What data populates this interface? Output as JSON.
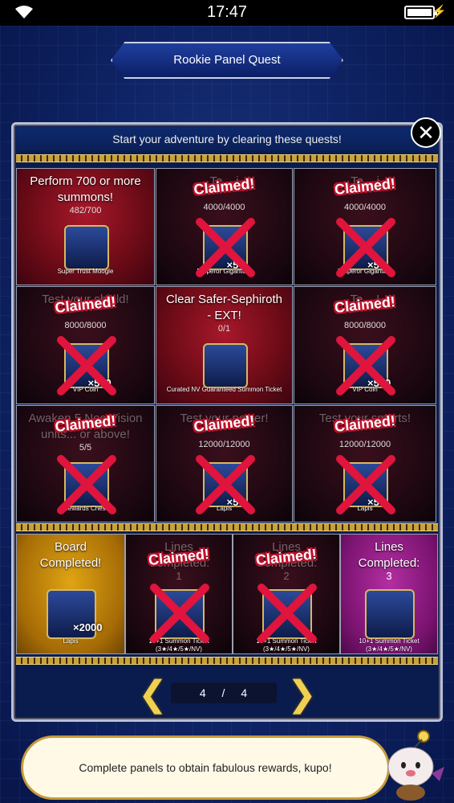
{
  "status": {
    "time": "17:47"
  },
  "header": {
    "title": "Rookie Panel Quest"
  },
  "panel": {
    "subtitle": "Start your adventure by clearing these quests!",
    "close_label": "✕"
  },
  "claimed_label": "Claimed!",
  "grid": [
    {
      "title": "Perform 700 or more summons!",
      "progress": "482/700",
      "reward": "Super Trust Moogle",
      "qty": "",
      "claimed": false,
      "style": "red"
    },
    {
      "title": "Te... i",
      "progress": "4000/4000",
      "reward": "Emperor Gigantuar",
      "qty": "×5",
      "claimed": true,
      "style": "dark"
    },
    {
      "title": "Te... i",
      "progress": "4000/4000",
      "reward": "Emperor Gigantuar",
      "qty": "×5",
      "claimed": true,
      "style": "dark"
    },
    {
      "title": "Test your shield!",
      "progress": "8000/8000",
      "reward": "VIP Coin",
      "qty": "×500",
      "claimed": true,
      "style": "dark"
    },
    {
      "title": "Clear Safer-Sephiroth - EXT!",
      "progress": "0/1",
      "reward": "Curated NV Guaranteed Summon Ticket",
      "qty": "",
      "claimed": false,
      "style": "red"
    },
    {
      "title": "Te... !",
      "progress": "8000/8000",
      "reward": "VIP Coin",
      "qty": "×500",
      "claimed": true,
      "style": "dark"
    },
    {
      "title": "Awaken 5 Neo Vision units... or above!",
      "progress": "5/5",
      "reward": "Rewards Chest",
      "qty": "",
      "claimed": true,
      "style": "dark"
    },
    {
      "title": "Test your power!",
      "progress": "12000/12000",
      "reward": "Lapis",
      "qty": "×50",
      "claimed": true,
      "style": "dark"
    },
    {
      "title": "Test your smarts!",
      "progress": "12000/12000",
      "reward": "Lapis",
      "qty": "×50",
      "claimed": true,
      "style": "dark"
    }
  ],
  "bottom": [
    {
      "title": "Board Completed!",
      "progress": "",
      "reward": "Lapis",
      "qty": "×2000",
      "claimed": false,
      "style": "gold"
    },
    {
      "title": "Lines Completed:",
      "progress": "1",
      "reward": "10+1 Summon Ticket (3★/4★/5★/NV)",
      "qty": "",
      "claimed": true,
      "style": "dark"
    },
    {
      "title": "Lines Completed:",
      "progress": "2",
      "reward": "10+1 Summon Ticket (3★/4★/5★/NV)",
      "qty": "",
      "claimed": true,
      "style": "dark"
    },
    {
      "title": "Lines Completed:",
      "progress": "3",
      "reward": "10+1 Summon Ticket (3★/4★/5★/NV)",
      "qty": "",
      "claimed": false,
      "style": "purple"
    }
  ],
  "pager": {
    "current": "4",
    "separator": "/",
    "total": "4",
    "prev": "❮",
    "next": "❯"
  },
  "speech": {
    "text": "Complete panels to obtain fabulous rewards, kupo!"
  },
  "colors": {
    "claimed_cross": "#e0143c",
    "gold_trim": "#c8a13a",
    "bg": "#0f2466"
  }
}
